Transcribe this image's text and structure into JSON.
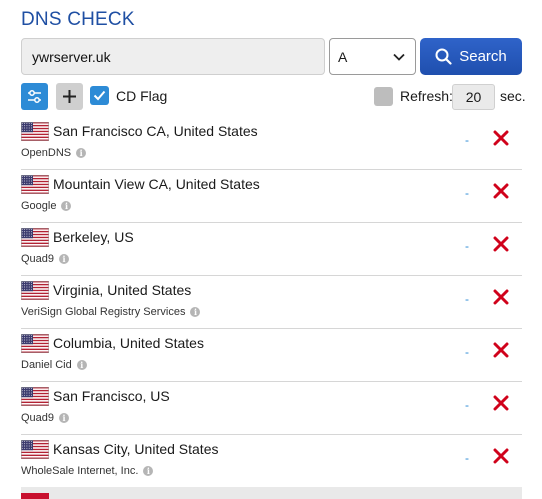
{
  "header": {
    "title": "DNS CHECK"
  },
  "search": {
    "domain_value": "ywrserver.uk",
    "record_type": "A",
    "search_label": "Search"
  },
  "options": {
    "cd_flag_label": "CD Flag",
    "cd_flag_checked": true,
    "refresh_label": "Refresh:",
    "refresh_value": "20",
    "sec_label": "sec."
  },
  "colors": {
    "accent": "#1f4fa3",
    "button": "#2a5bbf",
    "delete": "#d0021b",
    "result": "#2d8bd6"
  },
  "servers": [
    {
      "location": "San Francisco CA, United States",
      "provider": "OpenDNS",
      "result": "-"
    },
    {
      "location": "Mountain View CA, United States",
      "provider": "Google",
      "result": "-"
    },
    {
      "location": "Berkeley, US",
      "provider": "Quad9",
      "result": "-"
    },
    {
      "location": "Virginia, United States",
      "provider": "VeriSign Global Registry Services",
      "result": "-"
    },
    {
      "location": "Columbia, United States",
      "provider": "Daniel Cid",
      "result": "-"
    },
    {
      "location": "San Francisco, US",
      "provider": "Quad9",
      "result": "-"
    },
    {
      "location": "Kansas City, United States",
      "provider": "WholeSale Internet, Inc.",
      "result": "-"
    }
  ]
}
